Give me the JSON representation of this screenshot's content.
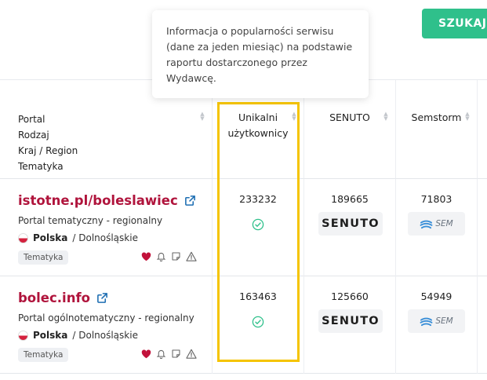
{
  "search_button": {
    "label": "SZUKAJ"
  },
  "tooltip": {
    "text": "Informacja o popularności serwisu (dane za jeden miesiąc) na podstawie raportu dostarczonego przez Wydawcę."
  },
  "columns": {
    "portal": [
      "Portal",
      "Rodzaj",
      "Kraj / Region",
      "Tematyka"
    ],
    "users": [
      "Unikalni",
      "użytkownicy"
    ],
    "senuto": "SENUTO",
    "semstorm": "Semstorm"
  },
  "rows": [
    {
      "name": "istotne.pl/boleslawiec",
      "type": "Portal tematyczny - regionalny",
      "country": "Polska",
      "region": "/ Dolnośląskie",
      "tag": "Tematyka",
      "users": "233232",
      "senuto_value": "189665",
      "semstorm_value": "71803"
    },
    {
      "name": "bolec.info",
      "type": "Portal ogólnotematyczny - regionalny",
      "country": "Polska",
      "region": "/ Dolnośląskie",
      "tag": "Tematyka",
      "users": "163463",
      "senuto_value": "125660",
      "semstorm_value": "54949"
    }
  ],
  "logos": {
    "senuto": "SENUTO",
    "semstorm": "SEM"
  },
  "icons": [
    "external-link-icon",
    "heart-icon",
    "bell-icon",
    "note-icon",
    "warning-icon",
    "check-circle-icon",
    "flag-poland-icon"
  ],
  "colors": {
    "brand": "#b0143c",
    "accent": "#2fc08b",
    "highlight": "#f5c400",
    "verified": "#2fc08b"
  }
}
